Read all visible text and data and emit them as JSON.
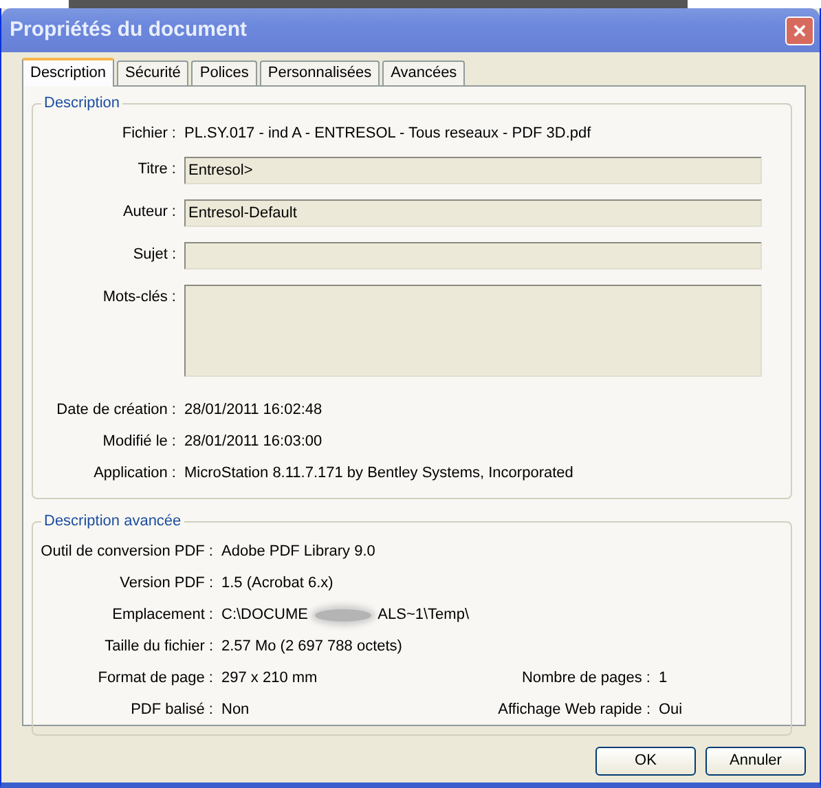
{
  "window": {
    "title": "Propriétés du document",
    "close": "×"
  },
  "tabs": [
    {
      "label": "Description",
      "selected": true
    },
    {
      "label": "Sécurité",
      "selected": false
    },
    {
      "label": "Polices",
      "selected": false
    },
    {
      "label": "Personnalisées",
      "selected": false
    },
    {
      "label": "Avancées",
      "selected": false
    }
  ],
  "description": {
    "title": "Description",
    "rows": [
      {
        "kind": "text",
        "label": "Fichier :",
        "value": "PL.SY.017 - ind A - ENTRESOL - Tous reseaux - PDF 3D.pdf"
      },
      {
        "kind": "field",
        "label": "Titre :",
        "value": "Entresol>"
      },
      {
        "kind": "field",
        "label": "Auteur :",
        "value": "Entresol-Default"
      },
      {
        "kind": "field",
        "label": "Sujet :",
        "value": ""
      },
      {
        "kind": "area",
        "label": "Mots-clés :",
        "value": ""
      },
      {
        "kind": "text",
        "label": "Date de création :",
        "value": "28/01/2011 16:02:48"
      },
      {
        "kind": "text",
        "label": "Modifié le :",
        "value": "28/01/2011 16:03:00"
      },
      {
        "kind": "text",
        "label": "Application :",
        "value": "MicroStation 8.11.7.171 by Bentley Systems, Incorporated"
      }
    ]
  },
  "advanced": {
    "title": "Description avancée",
    "rows": [
      {
        "label": "Outil de conversion PDF :",
        "value": "Adobe PDF Library 9.0"
      },
      {
        "label": "Version PDF :",
        "value": "1.5 (Acrobat 6.x)"
      },
      {
        "label": "Emplacement :",
        "value": "C:\\DOCUME",
        "redacted": true,
        "value_end": "ALS~1\\Temp\\"
      },
      {
        "label": "Taille du fichier :",
        "value": "2.57 Mo (2 697 788 octets)"
      },
      {
        "label": "Format de page :",
        "value": "297 x 210 mm",
        "label_2": "Nombre de pages :",
        "value_2": "1"
      },
      {
        "label": "PDF balisé :",
        "value": "Non",
        "label_2": "Affichage Web rapide :",
        "value_2": "Oui"
      }
    ]
  },
  "buttons": [
    "OK",
    "Annuler"
  ]
}
